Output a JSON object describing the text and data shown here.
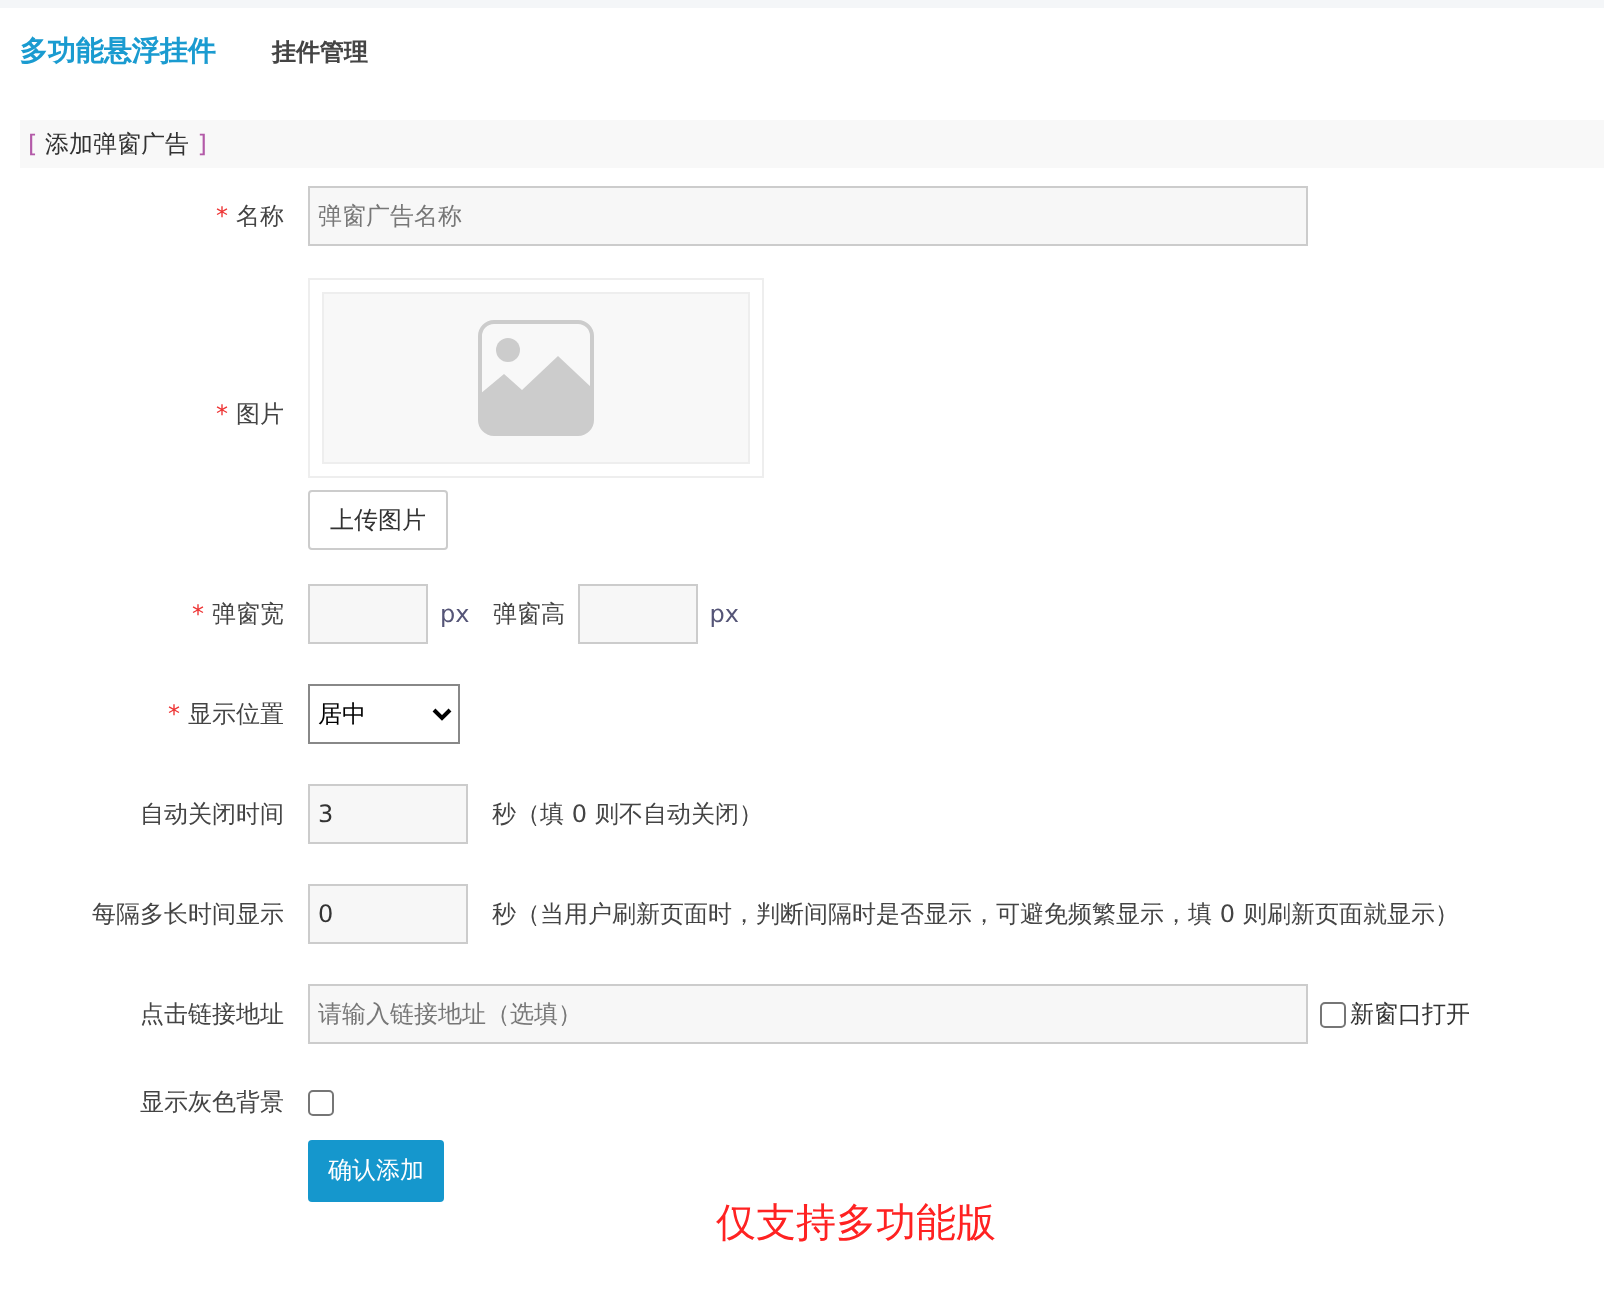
{
  "header": {
    "title": "多功能悬浮挂件",
    "link": "挂件管理"
  },
  "section": {
    "title": "添加弹窗广告",
    "bracket_open": "[",
    "bracket_close": "]"
  },
  "rows": [
    {
      "kind": "text",
      "required_mark": "*",
      "label": "名称",
      "placeholder": "弹窗广告名称"
    },
    {
      "kind": "image",
      "required_mark": "*",
      "label": "图片",
      "button": "上传图片"
    },
    {
      "kind": "size",
      "required_mark": "*",
      "label": "弹窗宽",
      "unit": "px",
      "label2": "弹窗高",
      "unit2": "px"
    },
    {
      "kind": "select",
      "required_mark": "*",
      "label": "显示位置",
      "value": "居中"
    },
    {
      "kind": "number",
      "label": "自动关闭时间",
      "value": "3",
      "hint": "秒（填 0 则不自动关闭）"
    },
    {
      "kind": "number",
      "label": "每隔多长时间显示",
      "value": "0",
      "hint": "秒（当用户刷新页面时，判断间隔时是否显示，可避免频繁显示，填 0 则刷新页面就显示）"
    },
    {
      "kind": "link",
      "label": "点击链接地址",
      "placeholder": "请输入链接地址（选填）",
      "option": "新窗口打开",
      "checked": false
    },
    {
      "kind": "checkbox",
      "label": "显示灰色背景",
      "checked": false
    },
    {
      "kind": "submit",
      "button": "确认添加",
      "notice": "仅支持多功能版"
    }
  ]
}
